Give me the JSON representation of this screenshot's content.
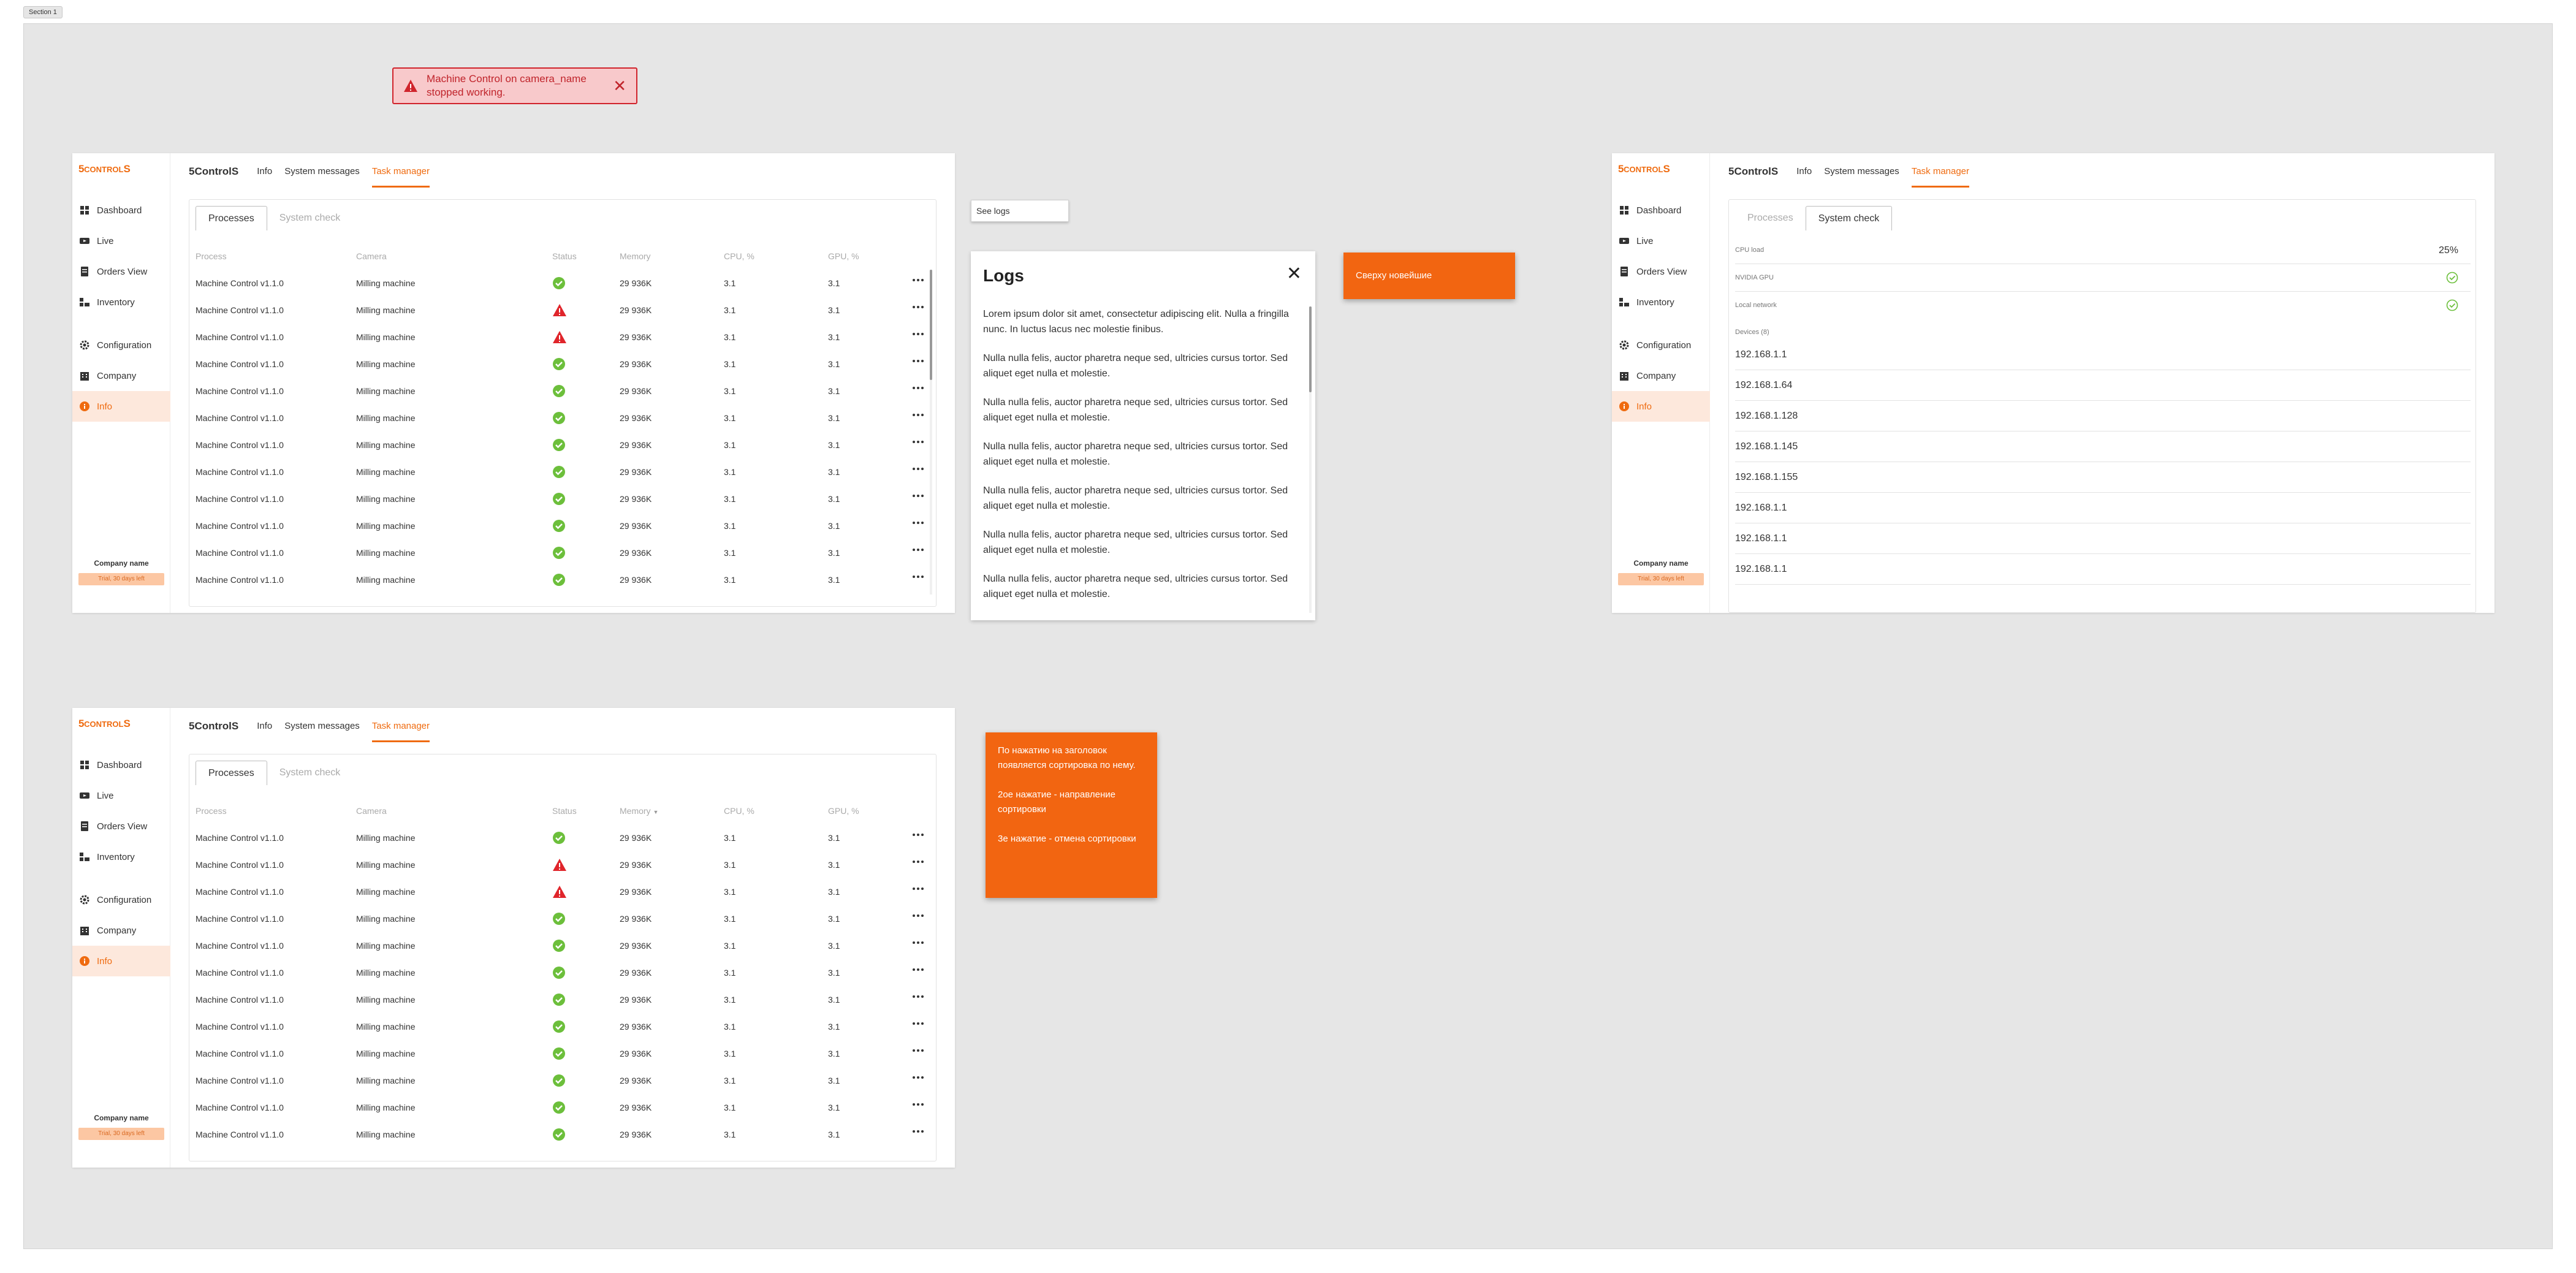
{
  "section_label": "Section 1",
  "toast": {
    "message": "Machine Control on camera_name stopped working.",
    "close": "✕"
  },
  "sidebar": {
    "logo_a": "5",
    "logo_b": "CONTROL",
    "logo_c": "S",
    "items": [
      {
        "label": "Dashboard",
        "icon": "dashboard-icon"
      },
      {
        "label": "Live",
        "icon": "live-icon"
      },
      {
        "label": "Orders View",
        "icon": "orders-icon"
      },
      {
        "label": "Inventory",
        "icon": "inventory-icon"
      },
      {
        "label": "Configuration",
        "icon": "gear-icon"
      },
      {
        "label": "Company",
        "icon": "company-icon"
      },
      {
        "label": "Info",
        "icon": "info-icon"
      }
    ],
    "company_name": "Company name",
    "trial": "Trial, 30 days left"
  },
  "topnav": {
    "brand": "5ControlS",
    "tabs": [
      "Info",
      "System messages",
      "Task manager"
    ]
  },
  "subtabs": [
    "Processes",
    "System check"
  ],
  "table": {
    "headers": [
      "Process",
      "Camera",
      "Status",
      "Memory",
      "CPU, %",
      "GPU, %"
    ],
    "rows": [
      {
        "process": "Machine Control v1.1.0",
        "camera": "Milling machine",
        "status": "ok",
        "memory": "29 936K",
        "cpu": "3.1",
        "gpu": "3.1"
      },
      {
        "process": "Machine Control v1.1.0",
        "camera": "Milling machine",
        "status": "warn",
        "memory": "29 936K",
        "cpu": "3.1",
        "gpu": "3.1"
      },
      {
        "process": "Machine Control v1.1.0",
        "camera": "Milling machine",
        "status": "warn",
        "memory": "29 936K",
        "cpu": "3.1",
        "gpu": "3.1"
      },
      {
        "process": "Machine Control v1.1.0",
        "camera": "Milling machine",
        "status": "ok",
        "memory": "29 936K",
        "cpu": "3.1",
        "gpu": "3.1"
      },
      {
        "process": "Machine Control v1.1.0",
        "camera": "Milling machine",
        "status": "ok",
        "memory": "29 936K",
        "cpu": "3.1",
        "gpu": "3.1"
      },
      {
        "process": "Machine Control v1.1.0",
        "camera": "Milling machine",
        "status": "ok",
        "memory": "29 936K",
        "cpu": "3.1",
        "gpu": "3.1"
      },
      {
        "process": "Machine Control v1.1.0",
        "camera": "Milling machine",
        "status": "ok",
        "memory": "29 936K",
        "cpu": "3.1",
        "gpu": "3.1"
      },
      {
        "process": "Machine Control v1.1.0",
        "camera": "Milling machine",
        "status": "ok",
        "memory": "29 936K",
        "cpu": "3.1",
        "gpu": "3.1"
      },
      {
        "process": "Machine Control v1.1.0",
        "camera": "Milling machine",
        "status": "ok",
        "memory": "29 936K",
        "cpu": "3.1",
        "gpu": "3.1"
      },
      {
        "process": "Machine Control v1.1.0",
        "camera": "Milling machine",
        "status": "ok",
        "memory": "29 936K",
        "cpu": "3.1",
        "gpu": "3.1"
      },
      {
        "process": "Machine Control v1.1.0",
        "camera": "Milling machine",
        "status": "ok",
        "memory": "29 936K",
        "cpu": "3.1",
        "gpu": "3.1"
      },
      {
        "process": "Machine Control v1.1.0",
        "camera": "Milling machine",
        "status": "ok",
        "memory": "29 936K",
        "cpu": "3.1",
        "gpu": "3.1"
      }
    ]
  },
  "see_logs": "See logs",
  "logs": {
    "title": "Logs",
    "close": "✕",
    "paragraphs": [
      "Lorem ipsum dolor sit amet, consectetur adipiscing elit. Nulla a fringilla nunc. In luctus lacus nec molestie finibus.",
      "Nulla nulla felis, auctor pharetra neque sed, ultricies cursus tortor. Sed aliquet eget nulla et molestie.",
      "Nulla nulla felis, auctor pharetra neque sed, ultricies cursus tortor. Sed aliquet eget nulla et molestie.",
      "Nulla nulla felis, auctor pharetra neque sed, ultricies cursus tortor. Sed aliquet eget nulla et molestie.",
      "Nulla nulla felis, auctor pharetra neque sed, ultricies cursus tortor. Sed aliquet eget nulla et molestie.",
      "Nulla nulla felis, auctor pharetra neque sed, ultricies cursus tortor. Sed aliquet eget nulla et molestie.",
      "Nulla nulla felis, auctor pharetra neque sed, ultricies cursus tortor. Sed aliquet eget nulla et molestie."
    ]
  },
  "note_newest": "Сверху новейшие",
  "note_sort": [
    "По нажатию на заголовок появляется сортировка по нему.",
    "2ое нажатие - направление сортировки",
    "3е нажатие - отмена сортировки"
  ],
  "system_check": {
    "cpu_label": "CPU load",
    "cpu_value": "25%",
    "gpu_label": "NVIDIA GPU",
    "network_label": "Local network",
    "devices_label": "Devices (8)",
    "devices": [
      "192.168.1.1",
      "192.168.1.64",
      "192.168.1.128",
      "192.168.1.145",
      "192.168.1.155",
      "192.168.1.1",
      "192.168.1.1",
      "192.168.1.1"
    ]
  },
  "colors": {
    "accent": "#ef6b10",
    "ok": "#6cbf3b",
    "warn": "#e0252b"
  }
}
